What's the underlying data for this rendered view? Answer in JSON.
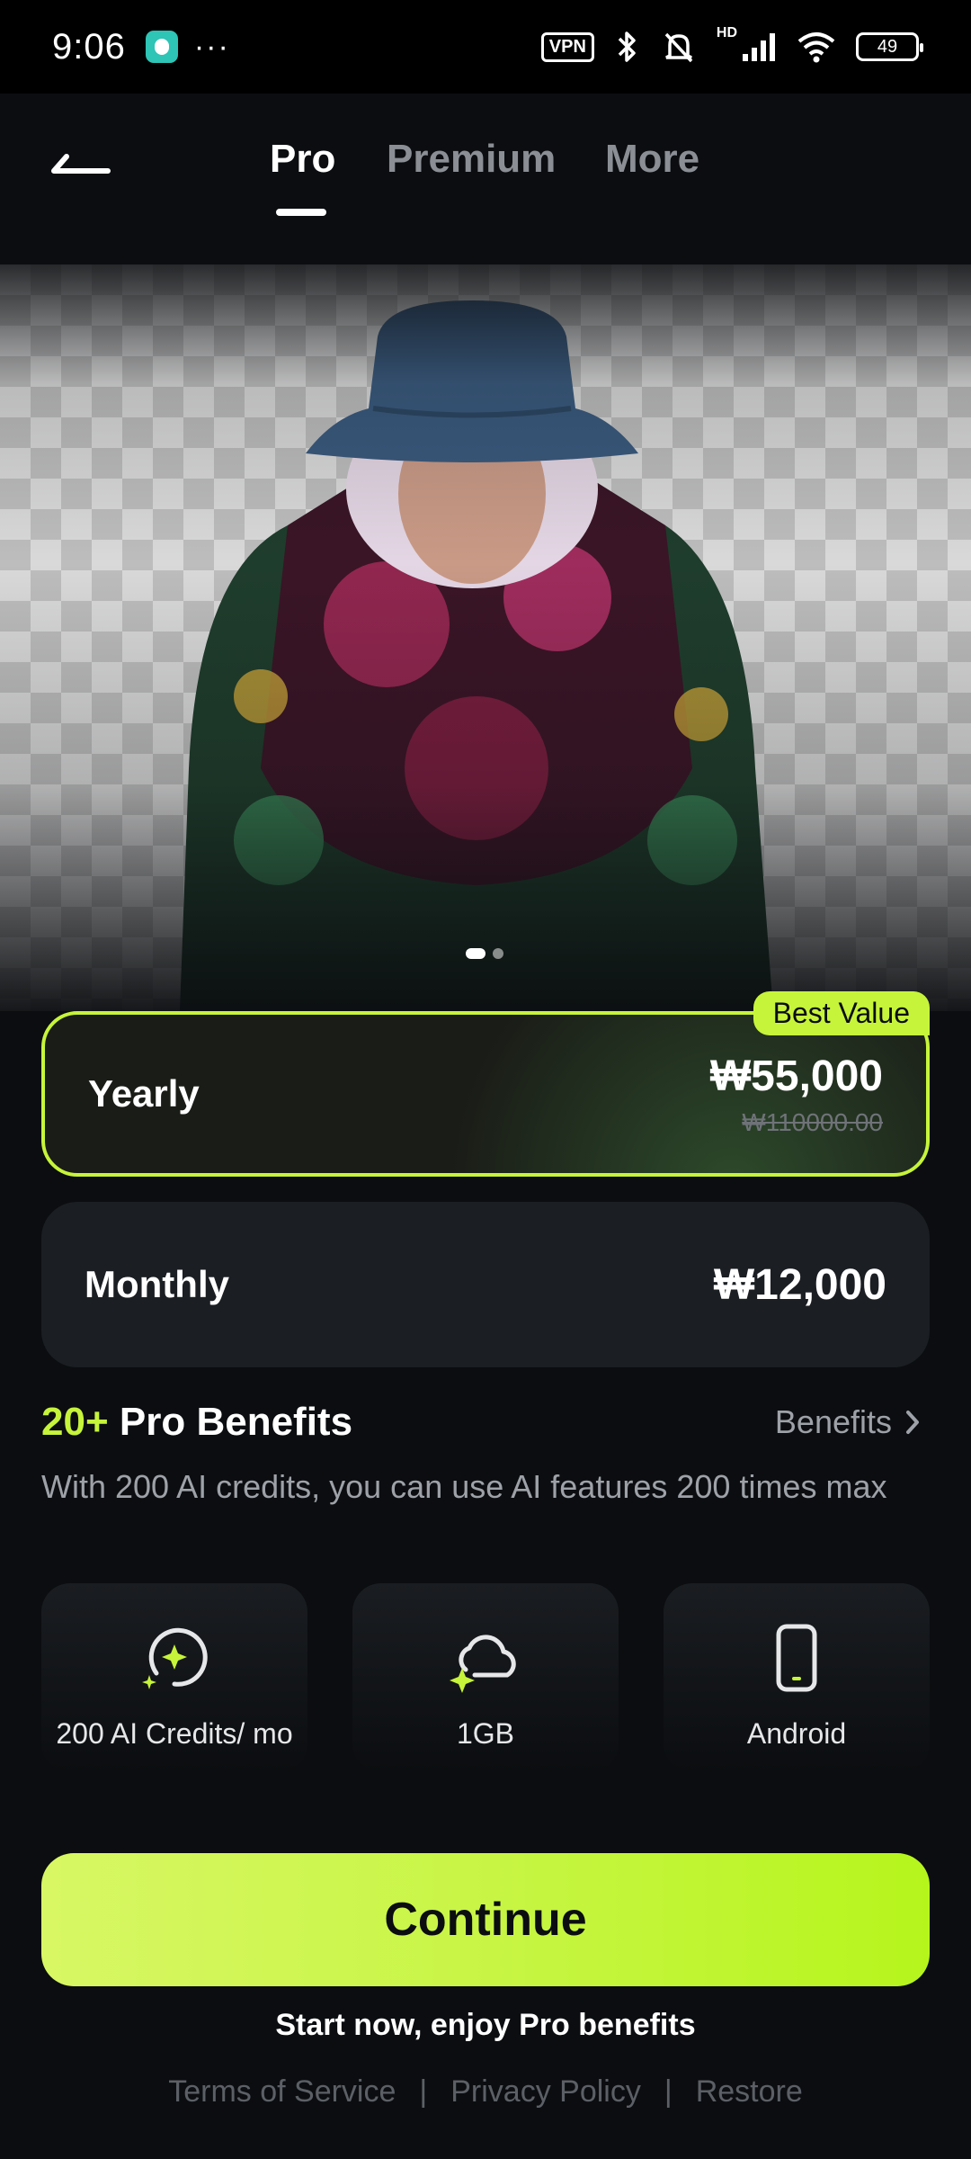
{
  "status_bar": {
    "time": "9:06",
    "more_dots": "···",
    "vpn": "VPN",
    "network": "HD",
    "battery": "49",
    "icons": [
      "app-icon",
      "bluetooth-icon",
      "mute-icon",
      "signal-icon",
      "wifi-icon",
      "battery-icon"
    ]
  },
  "header": {
    "back_icon": "back-arrow-icon",
    "tabs": [
      {
        "label": "Pro",
        "active": true
      },
      {
        "label": "Premium",
        "active": false
      },
      {
        "label": "More",
        "active": false
      }
    ]
  },
  "hero": {
    "pager": {
      "count": 2,
      "active_index": 0
    }
  },
  "plans": {
    "yearly": {
      "name": "Yearly",
      "price": "₩55,000",
      "original_price": "₩110000.00",
      "badge": "Best Value",
      "selected": true
    },
    "monthly": {
      "name": "Monthly",
      "price": "₩12,000",
      "selected": false
    }
  },
  "benefits": {
    "count": "20+",
    "title": "Pro Benefits",
    "link": "Benefits",
    "description": "With 200 AI credits, you can use AI features 200 times max",
    "features": [
      {
        "icon": "ai-credits-icon",
        "label": "200 AI Credits/ mo"
      },
      {
        "icon": "cloud-storage-icon",
        "label": "1GB"
      },
      {
        "icon": "phone-icon",
        "label": "Android"
      }
    ]
  },
  "cta": {
    "button": "Continue",
    "subtitle": "Start now, enjoy Pro benefits"
  },
  "footer": {
    "terms": "Terms of Service",
    "privacy": "Privacy Policy",
    "restore": "Restore",
    "separator": "|"
  },
  "colors": {
    "accent": "#c6f43a",
    "background": "#0b0d10",
    "card": "#1b1e22",
    "muted_text": "#9ea2a8"
  }
}
